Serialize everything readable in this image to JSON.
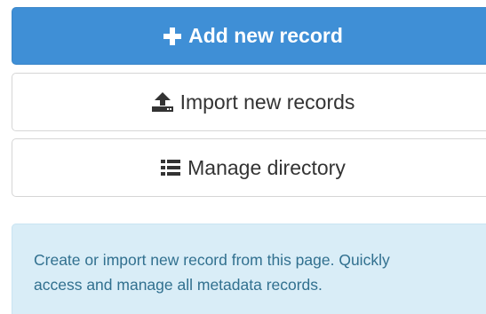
{
  "actions": {
    "add_label": "Add new record",
    "import_label": "Import new records",
    "manage_label": "Manage directory",
    "add_icon": "plus-icon",
    "import_icon": "upload-icon",
    "manage_icon": "list-icon",
    "primary_color": "#3f8fd6"
  },
  "info": {
    "line1": "Create or import new record from this page. Quickly",
    "line2": "access and manage all metadata records.",
    "background_color": "#d9edf7",
    "text_color": "#31708f"
  }
}
